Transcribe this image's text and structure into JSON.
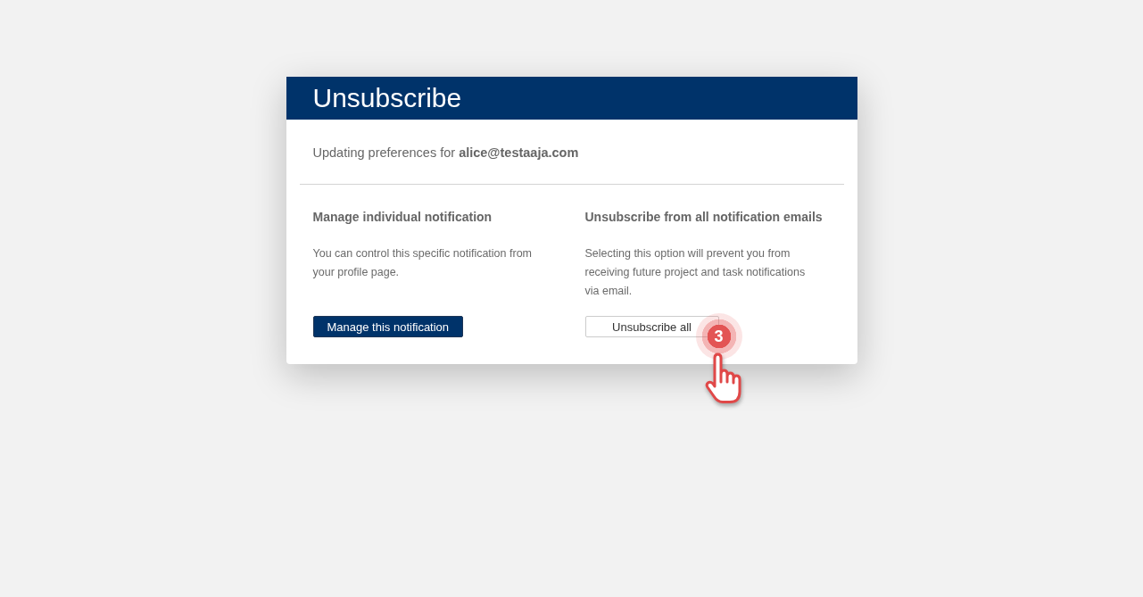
{
  "dialog": {
    "title": "Unsubscribe",
    "intro": "Updating preferences for **alice@testaaja.com**"
  },
  "options": [
    {
      "heading": "Manage individual notification",
      "description": "You can control this specific notification from your profile page.",
      "button": {
        "label": "Manage this notification",
        "kind": "primary"
      }
    },
    {
      "heading": "Unsubscribe from all notification emails",
      "description": "Selecting this option will prevent you from receiving future project and task notifications via email.",
      "button": {
        "label": "Unsubscribe all",
        "kind": "secondary"
      },
      "step_marker": "3"
    }
  ]
}
